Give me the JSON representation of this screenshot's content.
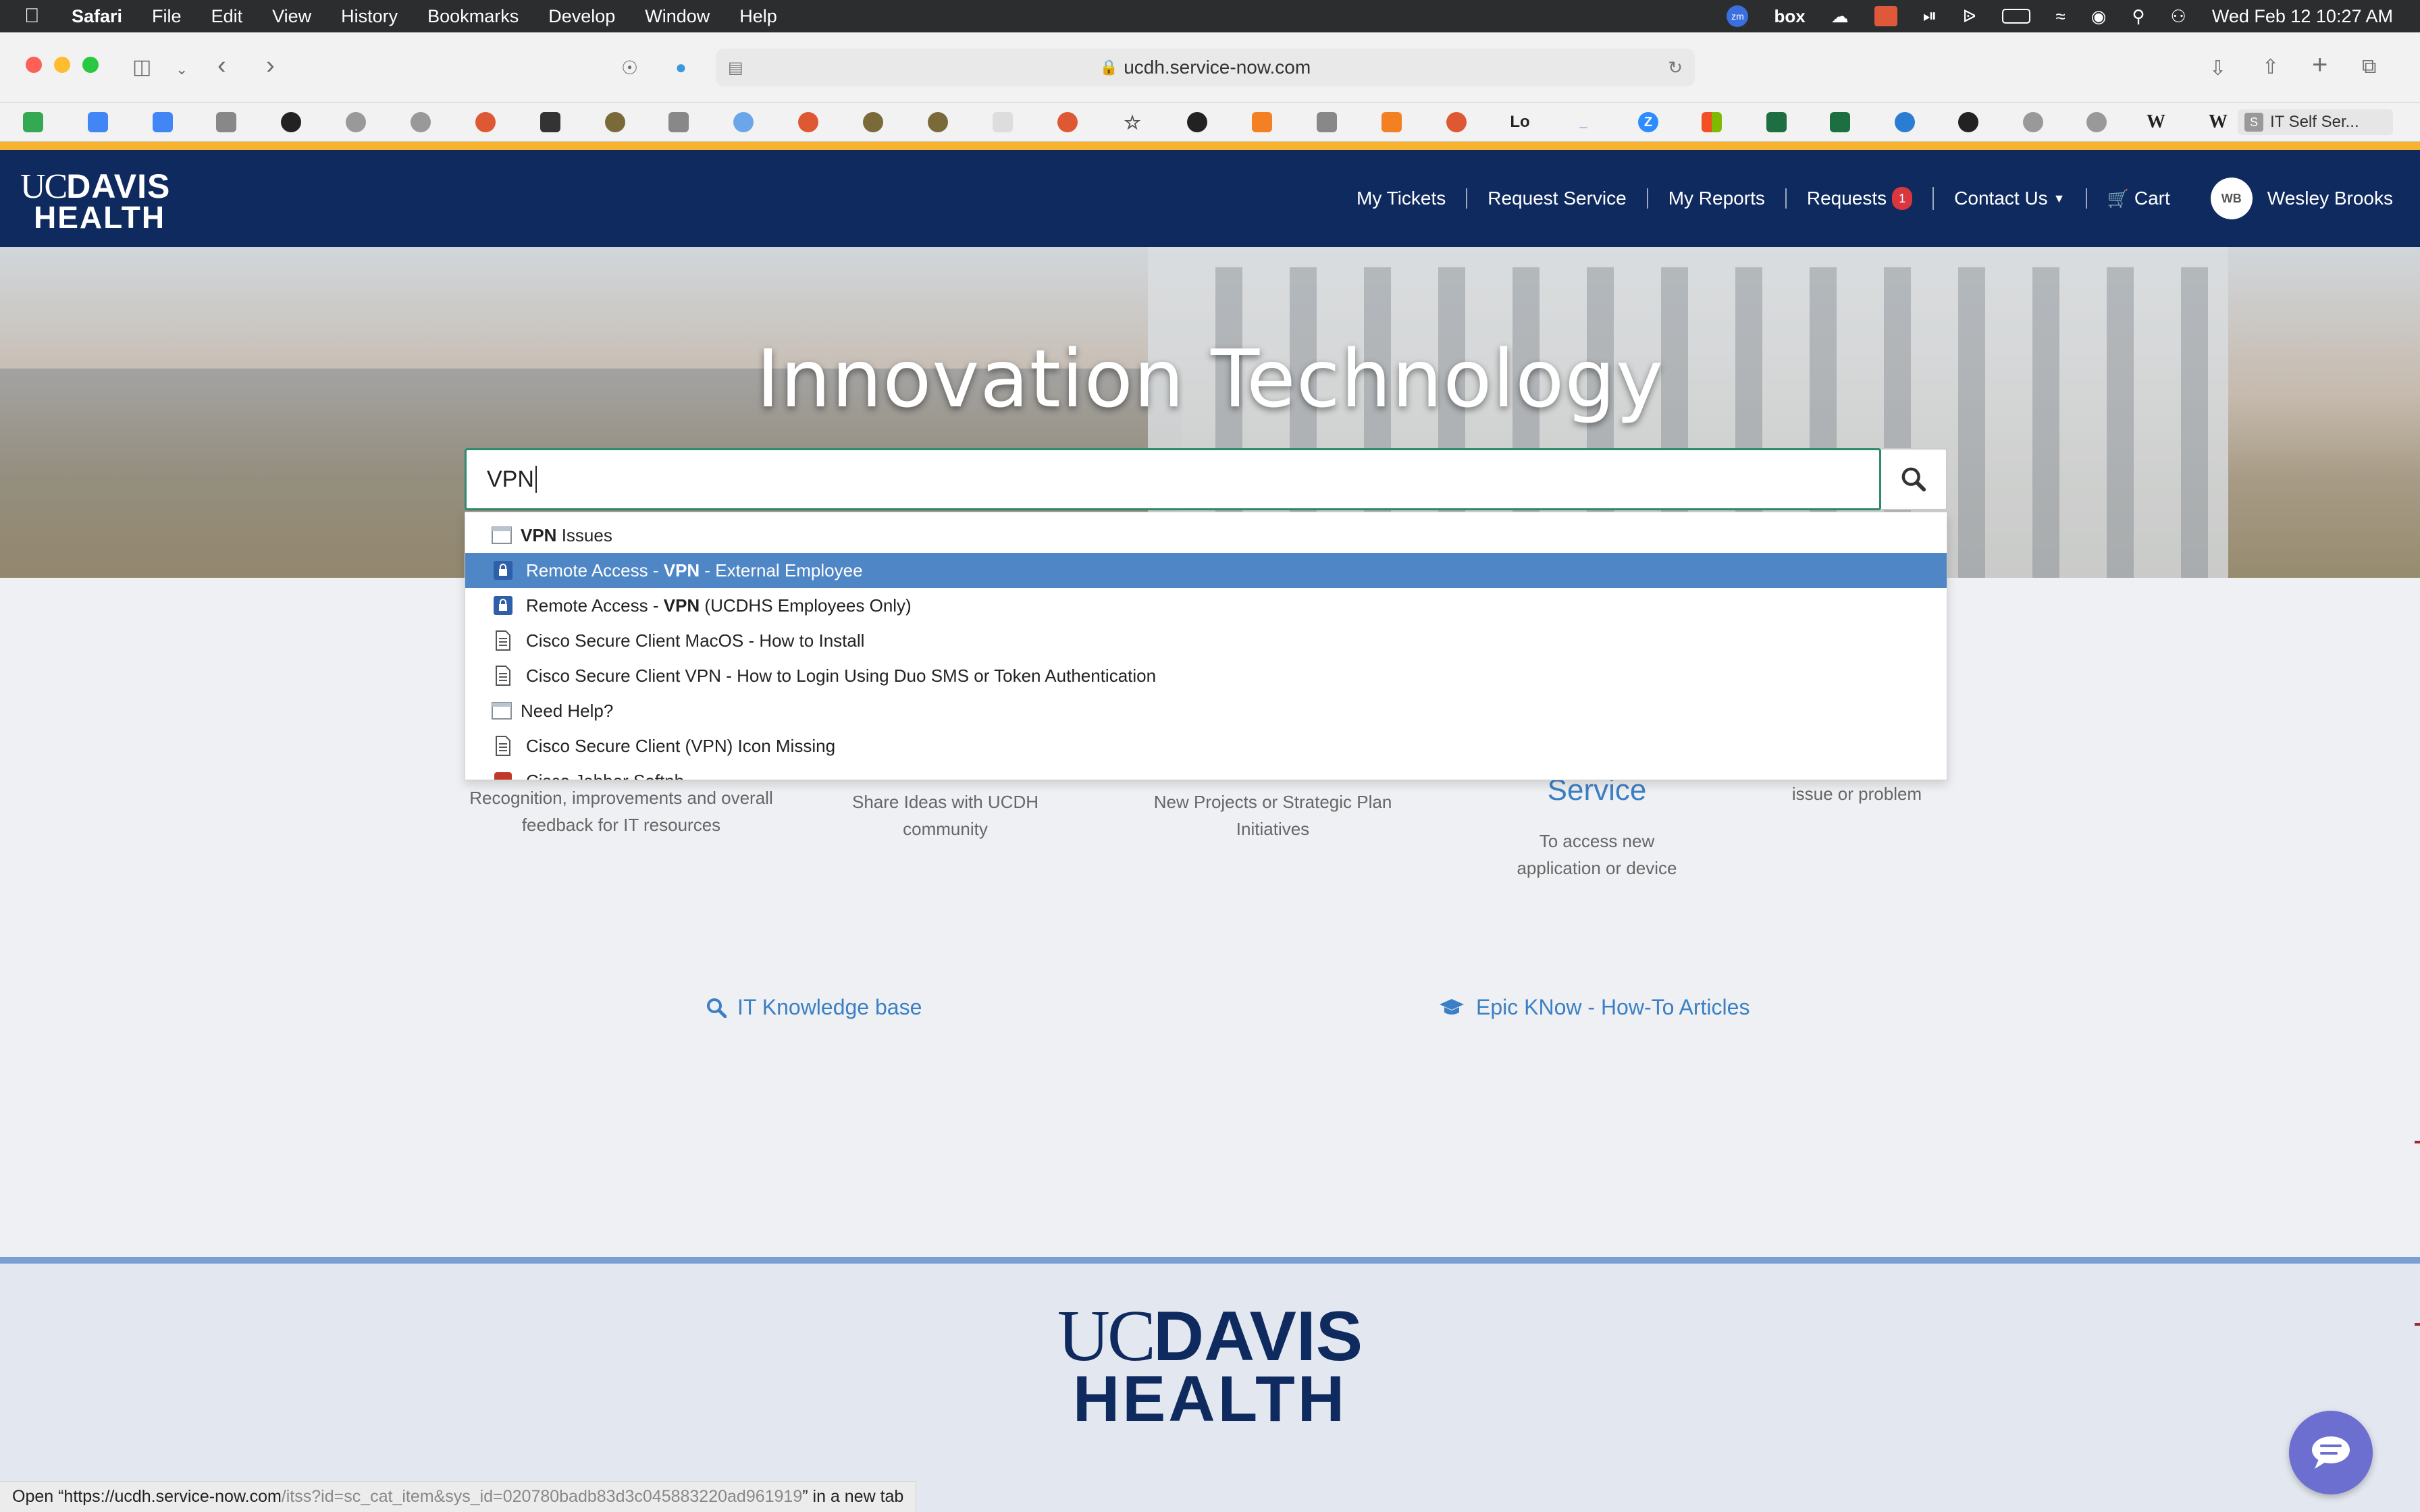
{
  "menubar": {
    "app": "Safari",
    "items": [
      "File",
      "Edit",
      "View",
      "History",
      "Bookmarks",
      "Develop",
      "Window",
      "Help"
    ],
    "clock": "Wed Feb 12  10:27 AM",
    "status_icons": [
      "zoom-icon",
      "box-icon",
      "cloud-icon",
      "key-icon",
      "play-icon",
      "bluetooth-icon",
      "battery-icon",
      "wifi-icon",
      "user-icon",
      "spotlight-icon",
      "control-center-icon"
    ],
    "box_label": "box"
  },
  "browser": {
    "url": "ucdh.service-now.com",
    "active_favorite_tab": "IT Self Ser..."
  },
  "site": {
    "logo_uc": "UC",
    "logo_davis": "DAVIS",
    "logo_health": "HEALTH",
    "nav": {
      "my_tickets": "My Tickets",
      "request_service": "Request Service",
      "my_reports": "My Reports",
      "requests": "Requests",
      "requests_badge": "1",
      "contact_us": "Contact Us",
      "cart": "Cart",
      "avatar_initials": "WB",
      "user_name": "Wesley Brooks"
    }
  },
  "hero": {
    "title": "Innovation Technology",
    "search_value": "VPN"
  },
  "dropdown": {
    "items": [
      {
        "bold": "VPN",
        "rest": " Issues",
        "pre": "",
        "icon": "catalog-icon"
      },
      {
        "pre": "Remote Access - ",
        "bold": "VPN",
        "rest": " - External Employee",
        "icon": "lock-item-icon"
      },
      {
        "pre": "Remote Access - ",
        "bold": "VPN",
        "rest": " (UCDHS Employees Only)",
        "icon": "lock-item-icon"
      },
      {
        "pre": "Cisco Secure Client MacOS - How to Install",
        "bold": "",
        "rest": "",
        "icon": "article-icon"
      },
      {
        "pre": "Cisco Secure Client VPN - How to Login Using Duo SMS or Token Authentication",
        "bold": "",
        "rest": "",
        "icon": "article-icon"
      },
      {
        "pre": "Need Help?",
        "bold": "",
        "rest": "",
        "icon": "catalog-icon"
      },
      {
        "pre": "Cisco Secure Client (VPN) Icon Missing",
        "bold": "",
        "rest": "",
        "icon": "article-icon"
      },
      {
        "pre": "Cisco Jabber Softph...",
        "bold": "",
        "rest": "",
        "icon": "app-icon"
      }
    ]
  },
  "cards": {
    "feedback_desc": "Recognition, improvements and overall feedback for IT resources",
    "ideas_desc": "Share Ideas with UCDH community",
    "projects_desc": "New Projects or Strategic Plan Initiatives",
    "service_title": "Service",
    "service_desc": "To access new application or device",
    "issue_desc": "issue or problem"
  },
  "links": {
    "kb": "IT Knowledge base",
    "epic": "Epic KNow - How-To Articles"
  },
  "statusbar": {
    "prefix": "Open “https://ucdh.service-now.com",
    "path": "/itss?id=sc_cat_item&sys_id=020780badb83d3c045883220ad961919",
    "suffix": "” in a new tab"
  },
  "colors": {
    "header_bg": "#0f2a5e",
    "accent_link": "#3b7fc4",
    "selected_row": "#4f86c6",
    "orange_strip": "#f7b230",
    "badge": "#d9363e"
  }
}
